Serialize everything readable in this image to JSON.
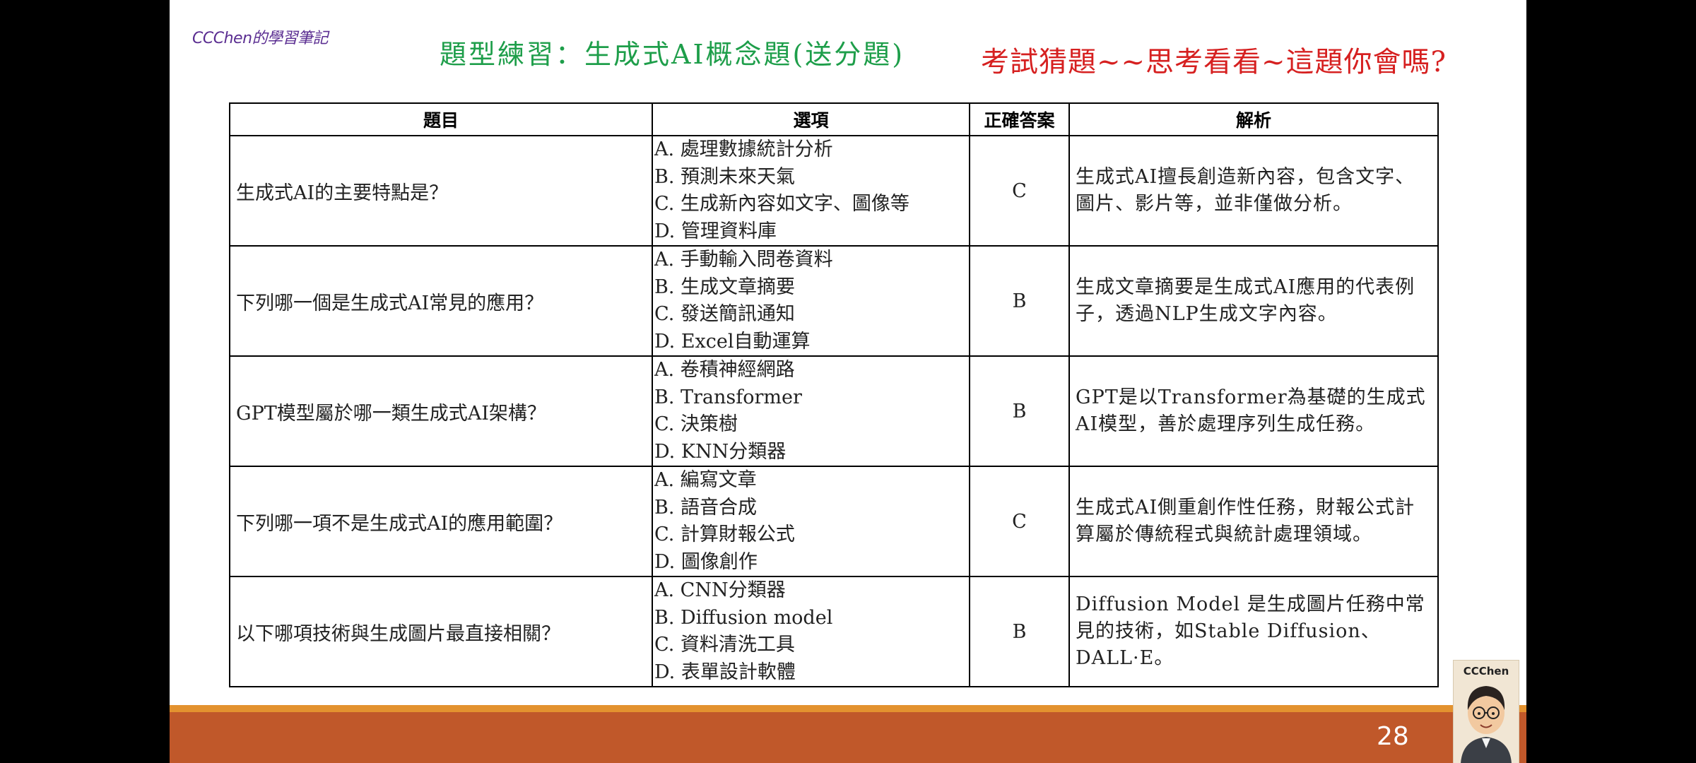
{
  "brand": "CCChen的學習筆記",
  "title_green": "題型練習：生成式AI概念題(送分題)",
  "title_red": "考試猜題~~思考看看~這題你會嗎?",
  "table": {
    "headers": [
      "題目",
      "選項",
      "正確答案",
      "解析"
    ],
    "rows": [
      {
        "question": "生成式AI的主要特點是？",
        "options": [
          "A.  處理數據統計分析",
          "B.  預測未來天氣",
          "C.  生成新內容如文字、圖像等",
          "D.  管理資料庫"
        ],
        "answer": "C",
        "explanation": "生成式AI擅長創造新內容，包含文字、圖片、影片等，並非僅做分析。"
      },
      {
        "question": "下列哪一個是生成式AI常見的應用？",
        "options": [
          "A.  手動輸入問卷資料",
          "B.  生成文章摘要",
          "C.  發送簡訊通知",
          "D.  Excel自動運算"
        ],
        "answer": "B",
        "explanation": "生成文章摘要是生成式AI應用的代表例子，透過NLP生成文字內容。"
      },
      {
        "question": "GPT模型屬於哪一類生成式AI架構？",
        "options": [
          "A.  卷積神經網路",
          "B.  Transformer",
          "C.  決策樹",
          "D.  KNN分類器"
        ],
        "answer": "B",
        "explanation": "GPT是以Transformer為基礎的生成式AI模型，善於處理序列生成任務。"
      },
      {
        "question": "下列哪一項不是生成式AI的應用範圍？",
        "options": [
          "A.  編寫文章",
          "B.  語音合成",
          "C.  計算財報公式",
          "D.  圖像創作"
        ],
        "answer": "C",
        "explanation": "生成式AI側重創作性任務，財報公式計算屬於傳統程式與統計處理領域。"
      },
      {
        "question": "以下哪項技術與生成圖片最直接相關？",
        "options": [
          "A.  CNN分類器",
          "B.  Diffusion model",
          "C.  資料清洗工具",
          "D.  表單設計軟體"
        ],
        "answer": "B",
        "explanation": "Diffusion Model 是生成圖片任務中常見的技術，如Stable Diffusion、DALL·E。"
      }
    ]
  },
  "page_number": "28",
  "avatar_name": "CCChen"
}
